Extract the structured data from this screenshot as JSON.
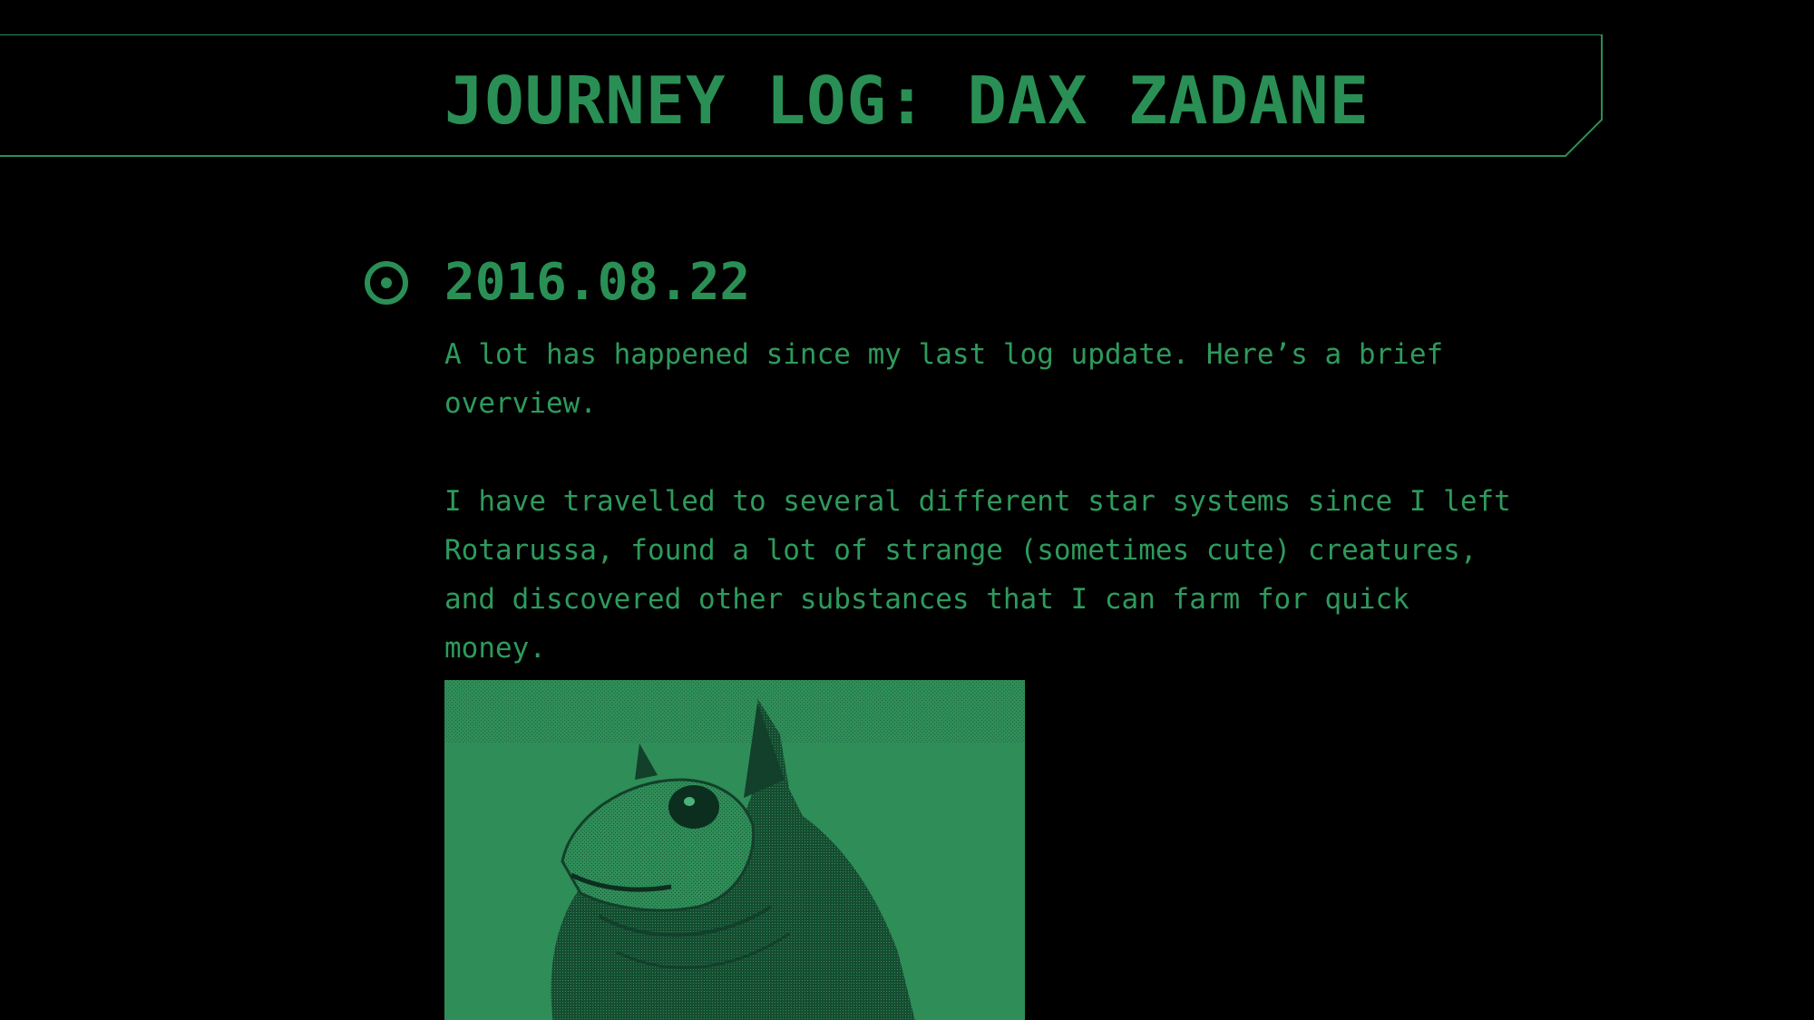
{
  "header": {
    "title": "JOURNEY LOG: DAX ZADANE"
  },
  "entry": {
    "icon": "target-circle-icon",
    "date": "2016.08.22",
    "paragraphs": [
      "A lot has happened since my last log update. Here’s a brief overview.",
      "I have travelled to several different star systems since I left Rotarussa, found a lot of strange (sometimes cute) creatures, and discovered other substances that I can farm for quick money."
    ],
    "image": {
      "description_icon": "creature-photo"
    }
  },
  "colors": {
    "accent": "#2e9a5c",
    "background": "#000000",
    "image_tint": "#2f8d58"
  }
}
